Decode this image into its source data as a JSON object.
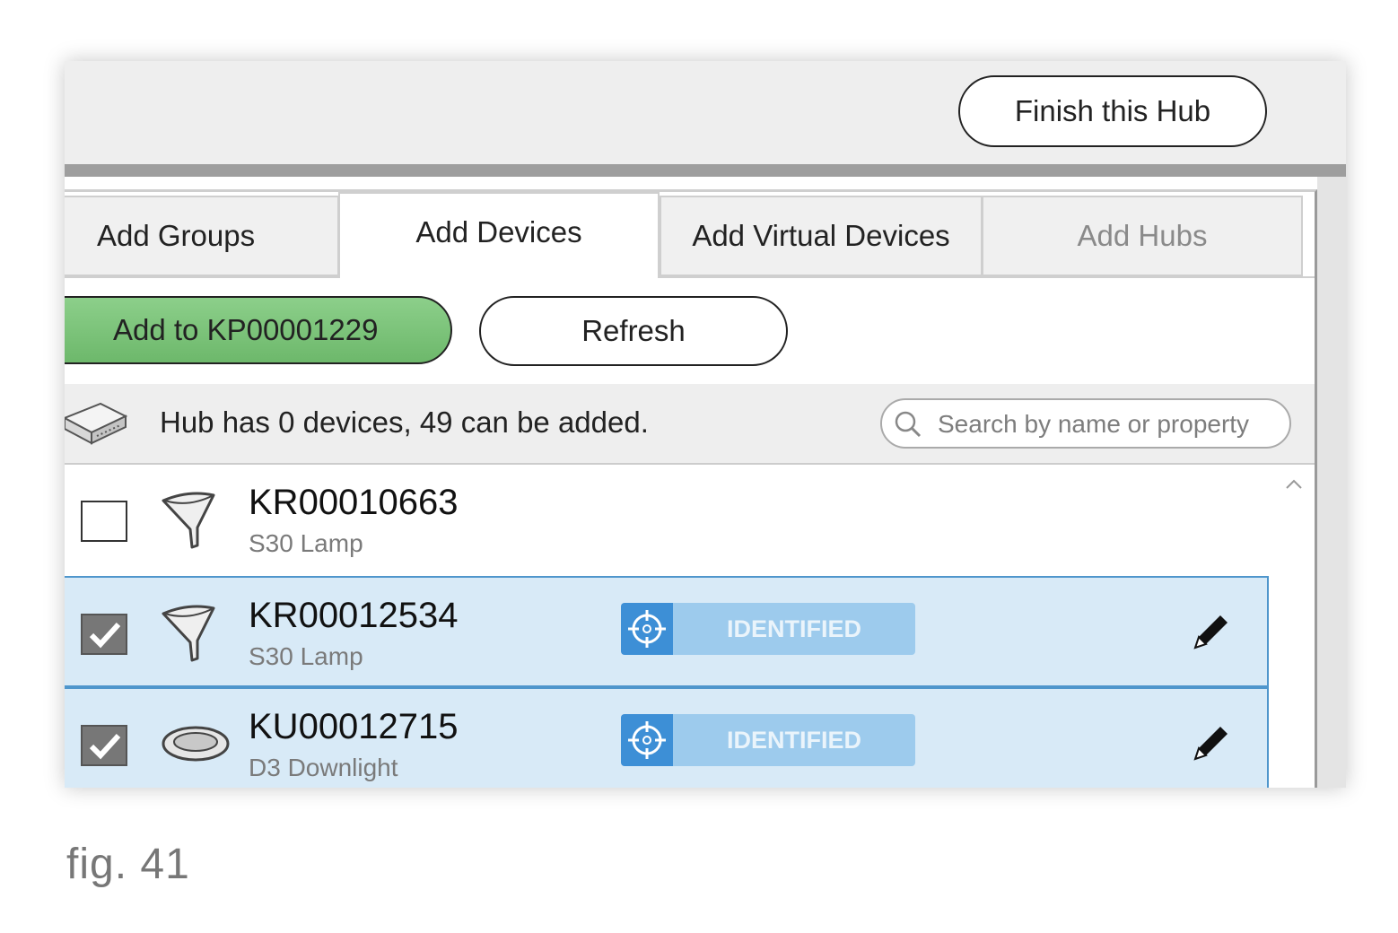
{
  "header": {
    "finish_label": "Finish this Hub"
  },
  "tabs": [
    {
      "label": "Add Groups",
      "state": "normal"
    },
    {
      "label": "Add Devices",
      "state": "active"
    },
    {
      "label": "Add Virtual Devices",
      "state": "normal"
    },
    {
      "label": "Add Hubs",
      "state": "disabled"
    }
  ],
  "actions": {
    "add_label": "Add to KP00001229",
    "refresh_label": "Refresh"
  },
  "status": {
    "text": "Hub has 0 devices, 49 can be added.",
    "hub_icon": "hub-icon"
  },
  "search": {
    "placeholder": "Search by name or property",
    "icon": "search-icon"
  },
  "devices": [
    {
      "name": "KR00010663",
      "type": "S30 Lamp",
      "checked": false,
      "identified": false,
      "icon": "lamp-icon"
    },
    {
      "name": "KR00012534",
      "type": "S30 Lamp",
      "checked": true,
      "identified": true,
      "badge": "IDENTIFIED",
      "icon": "lamp-icon"
    },
    {
      "name": "KU00012715",
      "type": "D3 Downlight",
      "checked": true,
      "identified": true,
      "badge": "IDENTIFIED",
      "icon": "downlight-icon"
    }
  ],
  "colors": {
    "add_button": "#7cc47a",
    "selected_row": "#d8eaf7",
    "identified_badge": "#9dcbed",
    "identified_icon_bg": "#3d8fd6"
  },
  "caption": "fig. 41"
}
